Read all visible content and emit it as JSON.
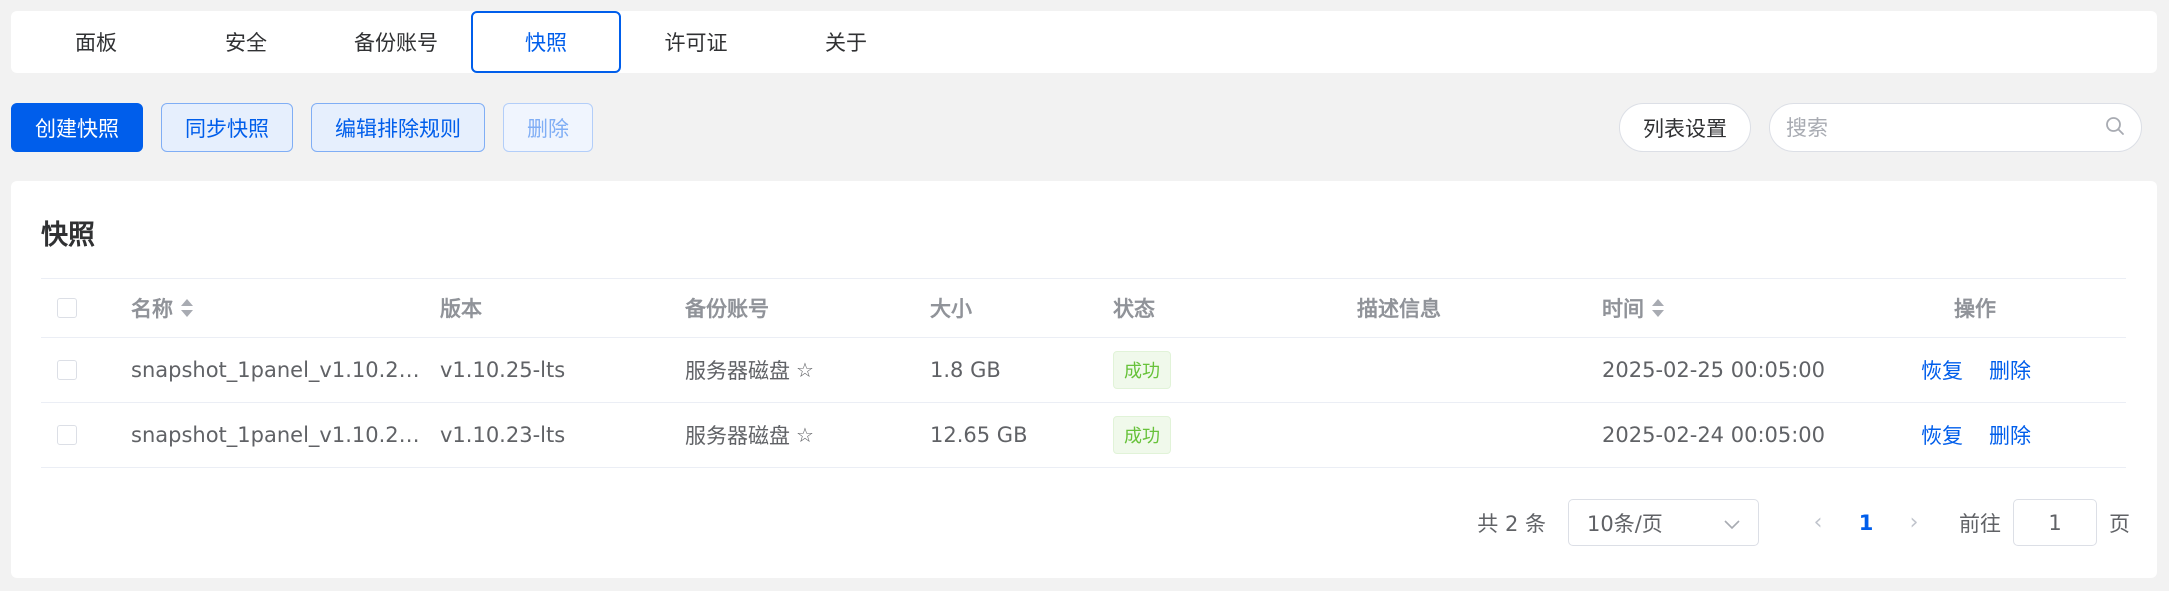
{
  "tabs": [
    {
      "label": "面板"
    },
    {
      "label": "安全"
    },
    {
      "label": "备份账号"
    },
    {
      "label": "快照"
    },
    {
      "label": "许可证"
    },
    {
      "label": "关于"
    }
  ],
  "active_tab": "快照",
  "toolbar": {
    "create_label": "创建快照",
    "sync_label": "同步快照",
    "edit_rules_label": "编辑排除规则",
    "delete_label": "删除",
    "list_settings_label": "列表设置",
    "search_placeholder": "搜索"
  },
  "card": {
    "title": "快照",
    "columns": {
      "name": "名称",
      "version": "版本",
      "account": "备份账号",
      "size": "大小",
      "status": "状态",
      "description": "描述信息",
      "time": "时间",
      "actions": "操作"
    },
    "rows": [
      {
        "name": "snapshot_1panel_v1.10.2…",
        "version": "v1.10.25-lts",
        "account": "服务器磁盘",
        "size": "1.8 GB",
        "status": "成功",
        "description": "",
        "time": "2025-02-25 00:05:00",
        "restore": "恢复",
        "delete": "删除"
      },
      {
        "name": "snapshot_1panel_v1.10.2…",
        "version": "v1.10.23-lts",
        "account": "服务器磁盘",
        "size": "12.65 GB",
        "status": "成功",
        "description": "",
        "time": "2025-02-24 00:05:00",
        "restore": "恢复",
        "delete": "删除"
      }
    ]
  },
  "pagination": {
    "total_text": "共 2 条",
    "page_size": "10条/页",
    "current_page": "1",
    "goto_label": "前往",
    "goto_value": "1",
    "page_suffix": "页"
  },
  "colors": {
    "primary": "#005eeb",
    "success": "#67c23a"
  }
}
